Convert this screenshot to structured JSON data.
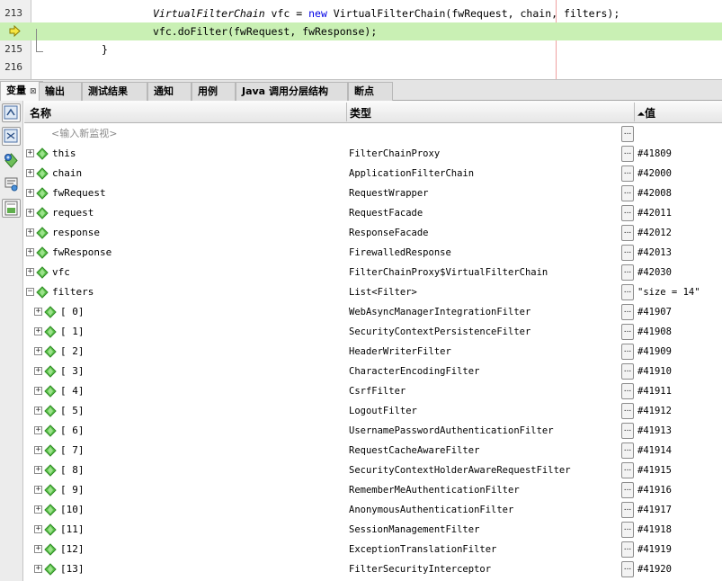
{
  "editor": {
    "lines": [
      {
        "num": "213",
        "pre": "VirtualFilterChain",
        "mid": " vfc = ",
        "kw": "new",
        "post": " VirtualFilterChain(fwRequest, chain, filters);"
      },
      {
        "num": "",
        "code": "vfc.doFilter(fwRequest, fwResponse);"
      },
      {
        "num": "215",
        "code": "}"
      },
      {
        "num": "216",
        "code": ""
      }
    ]
  },
  "tabs": [
    {
      "label": "变量",
      "close": "⊠"
    },
    {
      "label": "输出"
    },
    {
      "label": "测试结果"
    },
    {
      "label": "通知"
    },
    {
      "label": "用例"
    },
    {
      "label": "Java 调用分层结构"
    },
    {
      "label": "断点"
    }
  ],
  "table": {
    "headers": {
      "name": "名称",
      "type": "类型",
      "value": "值",
      "sort_glyph": "⏶"
    },
    "watch_placeholder": "<输入新监视>",
    "dots": "...",
    "rows": [
      {
        "name": "this",
        "type": "FilterChainProxy",
        "value": "#41809",
        "level": 0,
        "expand": "+"
      },
      {
        "name": "chain",
        "type": "ApplicationFilterChain",
        "value": "#42000",
        "level": 0,
        "expand": "+"
      },
      {
        "name": "fwRequest",
        "type": "RequestWrapper",
        "value": "#42008",
        "level": 0,
        "expand": "+"
      },
      {
        "name": "request",
        "type": "RequestFacade",
        "value": "#42011",
        "level": 0,
        "expand": "+"
      },
      {
        "name": "response",
        "type": "ResponseFacade",
        "value": "#42012",
        "level": 0,
        "expand": "+"
      },
      {
        "name": "fwResponse",
        "type": "FirewalledResponse",
        "value": "#42013",
        "level": 0,
        "expand": "+"
      },
      {
        "name": "vfc",
        "type": "FilterChainProxy$VirtualFilterChain",
        "value": "#42030",
        "level": 0,
        "expand": "+"
      },
      {
        "name": "filters",
        "type": "List<Filter>",
        "value": "\"size = 14\"",
        "level": 0,
        "expand": "−"
      },
      {
        "name": "[ 0]",
        "type": "WebAsyncManagerIntegrationFilter",
        "value": "#41907",
        "level": 1,
        "expand": "+"
      },
      {
        "name": "[ 1]",
        "type": "SecurityContextPersistenceFilter",
        "value": "#41908",
        "level": 1,
        "expand": "+"
      },
      {
        "name": "[ 2]",
        "type": "HeaderWriterFilter",
        "value": "#41909",
        "level": 1,
        "expand": "+"
      },
      {
        "name": "[ 3]",
        "type": "CharacterEncodingFilter",
        "value": "#41910",
        "level": 1,
        "expand": "+"
      },
      {
        "name": "[ 4]",
        "type": "CsrfFilter",
        "value": "#41911",
        "level": 1,
        "expand": "+"
      },
      {
        "name": "[ 5]",
        "type": "LogoutFilter",
        "value": "#41912",
        "level": 1,
        "expand": "+"
      },
      {
        "name": "[ 6]",
        "type": "UsernamePasswordAuthenticationFilter",
        "value": "#41913",
        "level": 1,
        "expand": "+"
      },
      {
        "name": "[ 7]",
        "type": "RequestCacheAwareFilter",
        "value": "#41914",
        "level": 1,
        "expand": "+"
      },
      {
        "name": "[ 8]",
        "type": "SecurityContextHolderAwareRequestFilter",
        "value": "#41915",
        "level": 1,
        "expand": "+"
      },
      {
        "name": "[ 9]",
        "type": "RememberMeAuthenticationFilter",
        "value": "#41916",
        "level": 1,
        "expand": "+"
      },
      {
        "name": "[10]",
        "type": "AnonymousAuthenticationFilter",
        "value": "#41917",
        "level": 1,
        "expand": "+"
      },
      {
        "name": "[11]",
        "type": "SessionManagementFilter",
        "value": "#41918",
        "level": 1,
        "expand": "+"
      },
      {
        "name": "[12]",
        "type": "ExceptionTranslationFilter",
        "value": "#41919",
        "level": 1,
        "expand": "+"
      },
      {
        "name": "[13]",
        "type": "FilterSecurityInterceptor",
        "value": "#41920",
        "level": 1,
        "expand": "+"
      }
    ]
  },
  "colors": {
    "current_line": "#c9f0b4",
    "keyword": "#0000e6",
    "gem_fill": "#5cc24a",
    "gem_dark": "#2e8a24"
  }
}
